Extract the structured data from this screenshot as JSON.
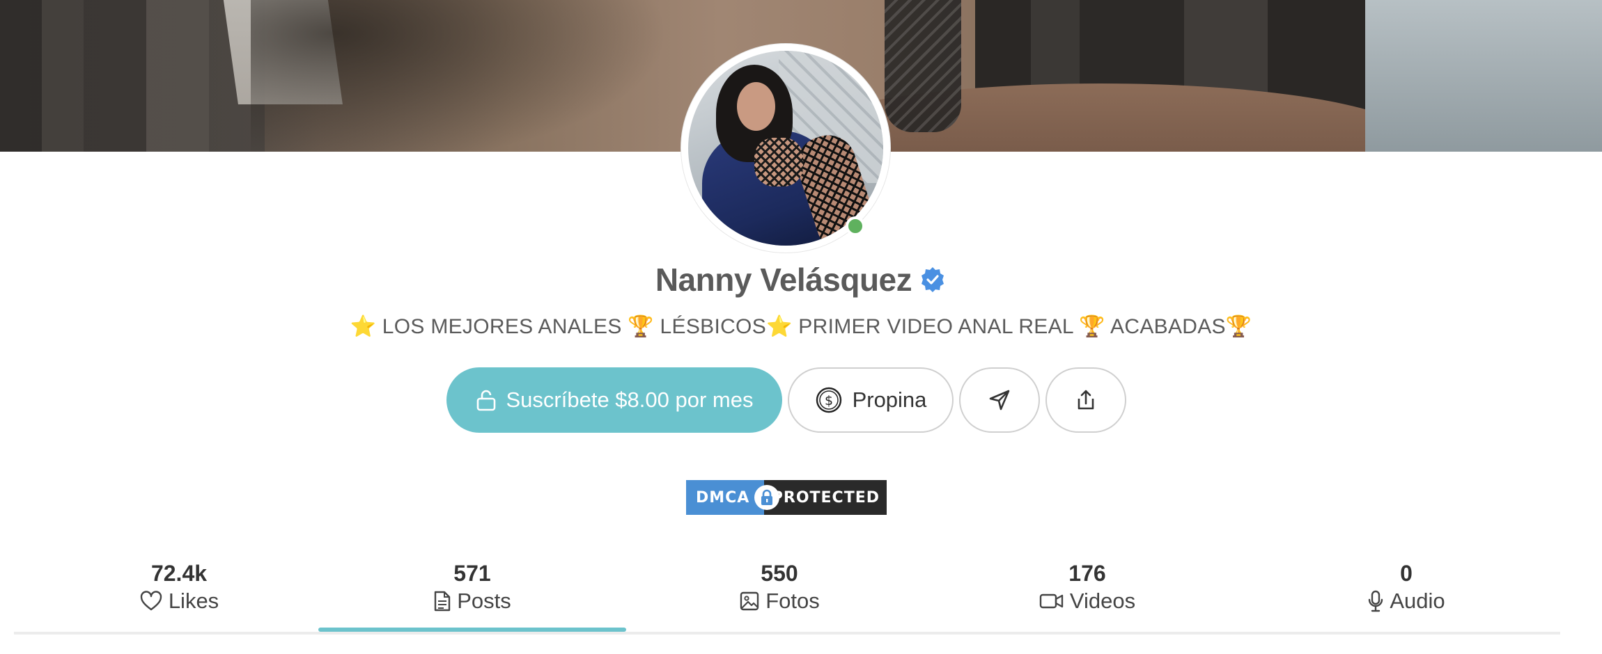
{
  "profile": {
    "name": "Nanny Velásquez",
    "verified": true,
    "online": true,
    "bio": "⭐️ LOS MEJORES ANALES 🏆 LÉSBICOS⭐️ PRIMER VIDEO ANAL REAL 🏆 ACABADAS🏆"
  },
  "actions": {
    "subscribe_label": "Suscríbete $8.00 por mes",
    "tip_label": "Propina"
  },
  "badge": {
    "left": "DMCA",
    "right": "PROTECTED"
  },
  "stats": [
    {
      "count": "72.4k",
      "label": "Likes",
      "icon": "heart-icon"
    },
    {
      "count": "571",
      "label": "Posts",
      "icon": "document-icon"
    },
    {
      "count": "550",
      "label": "Fotos",
      "icon": "image-icon"
    },
    {
      "count": "176",
      "label": "Videos",
      "icon": "video-camera-icon"
    },
    {
      "count": "0",
      "label": "Audio",
      "icon": "microphone-icon"
    }
  ],
  "active_tab": "Posts",
  "colors": {
    "accent": "#6cc3cc",
    "online": "#5fb15e",
    "verified": "#4a90e2",
    "dmca_blue": "#4a8fd4",
    "dmca_dark": "#2a2a2a"
  }
}
